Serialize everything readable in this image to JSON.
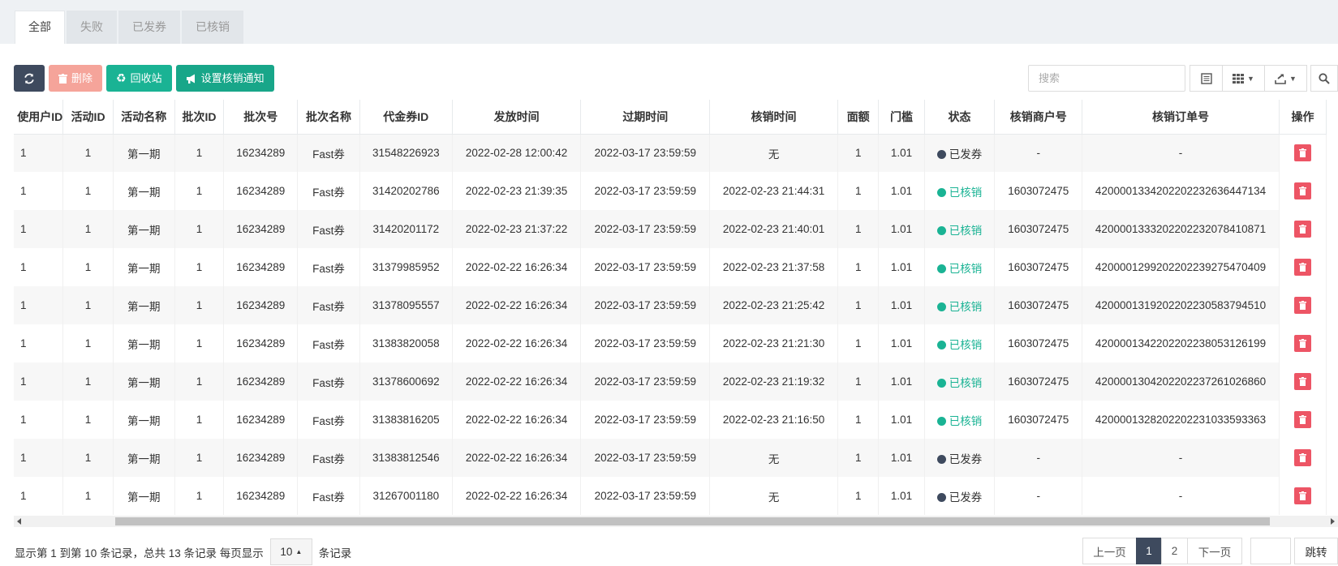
{
  "tabs": [
    "全部",
    "失败",
    "已发券",
    "已核销"
  ],
  "toolbar": {
    "refresh_icon": "refresh-icon",
    "delete_label": "删除",
    "recycle_label": "回收站",
    "notify_label": "设置核销通知",
    "search_placeholder": "搜索"
  },
  "columns": [
    "使用户ID",
    "活动ID",
    "活动名称",
    "批次ID",
    "批次号",
    "批次名称",
    "代金券ID",
    "发放时间",
    "过期时间",
    "核销时间",
    "面额",
    "门槛",
    "状态",
    "核销商户号",
    "核销订单号",
    "操作"
  ],
  "rows": [
    [
      "1",
      "1",
      "第一期",
      "1",
      "16234289",
      "Fast券",
      "31548226923",
      "2022-02-28 12:00:42",
      "2022-03-17 23:59:59",
      "无",
      "1",
      "1.01",
      "已发券",
      "-",
      "-"
    ],
    [
      "1",
      "1",
      "第一期",
      "1",
      "16234289",
      "Fast券",
      "31420202786",
      "2022-02-23 21:39:35",
      "2022-03-17 23:59:59",
      "2022-02-23 21:44:31",
      "1",
      "1.01",
      "已核销",
      "1603072475",
      "4200001334202202232636447134"
    ],
    [
      "1",
      "1",
      "第一期",
      "1",
      "16234289",
      "Fast券",
      "31420201172",
      "2022-02-23 21:37:22",
      "2022-03-17 23:59:59",
      "2022-02-23 21:40:01",
      "1",
      "1.01",
      "已核销",
      "1603072475",
      "4200001333202202232078410871"
    ],
    [
      "1",
      "1",
      "第一期",
      "1",
      "16234289",
      "Fast券",
      "31379985952",
      "2022-02-22 16:26:34",
      "2022-03-17 23:59:59",
      "2022-02-23 21:37:58",
      "1",
      "1.01",
      "已核销",
      "1603072475",
      "4200001299202202239275470409"
    ],
    [
      "1",
      "1",
      "第一期",
      "1",
      "16234289",
      "Fast券",
      "31378095557",
      "2022-02-22 16:26:34",
      "2022-03-17 23:59:59",
      "2022-02-23 21:25:42",
      "1",
      "1.01",
      "已核销",
      "1603072475",
      "4200001319202202230583794510"
    ],
    [
      "1",
      "1",
      "第一期",
      "1",
      "16234289",
      "Fast券",
      "31383820058",
      "2022-02-22 16:26:34",
      "2022-03-17 23:59:59",
      "2022-02-23 21:21:30",
      "1",
      "1.01",
      "已核销",
      "1603072475",
      "4200001342202202238053126199"
    ],
    [
      "1",
      "1",
      "第一期",
      "1",
      "16234289",
      "Fast券",
      "31378600692",
      "2022-02-22 16:26:34",
      "2022-03-17 23:59:59",
      "2022-02-23 21:19:32",
      "1",
      "1.01",
      "已核销",
      "1603072475",
      "4200001304202202237261026860"
    ],
    [
      "1",
      "1",
      "第一期",
      "1",
      "16234289",
      "Fast券",
      "31383816205",
      "2022-02-22 16:26:34",
      "2022-03-17 23:59:59",
      "2022-02-23 21:16:50",
      "1",
      "1.01",
      "已核销",
      "1603072475",
      "4200001328202202231033593363"
    ],
    [
      "1",
      "1",
      "第一期",
      "1",
      "16234289",
      "Fast券",
      "31383812546",
      "2022-02-22 16:26:34",
      "2022-03-17 23:59:59",
      "无",
      "1",
      "1.01",
      "已发券",
      "-",
      "-"
    ],
    [
      "1",
      "1",
      "第一期",
      "1",
      "16234289",
      "Fast券",
      "31267001180",
      "2022-02-22 16:26:34",
      "2022-03-17 23:59:59",
      "无",
      "1",
      "1.01",
      "已发券",
      "-",
      "-"
    ]
  ],
  "status_colors": {
    "已发券": "#3e4a5e",
    "已核销": "#1ab394"
  },
  "footer": {
    "prefix": "显示第 1 到第 10 条记录，总共 13 条记录 每页显示",
    "page_size": "10",
    "suffix": "条记录"
  },
  "pager": {
    "prev": "上一页",
    "pages": [
      "1",
      "2"
    ],
    "next": "下一页",
    "jump": "跳转"
  }
}
